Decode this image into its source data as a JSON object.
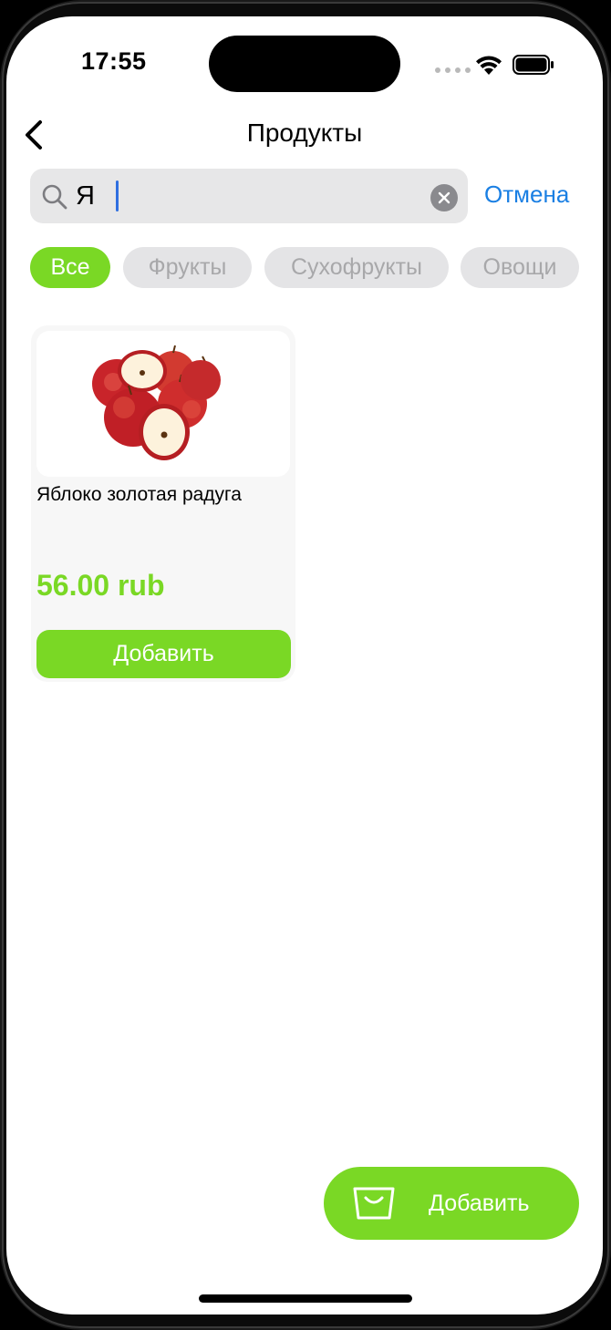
{
  "status_bar": {
    "time": "17:55"
  },
  "nav": {
    "title": "Продукты",
    "back_icon": "chevron-left-icon"
  },
  "search": {
    "value": "Я",
    "cancel_label": "Отмена"
  },
  "chips": [
    {
      "label": "Все",
      "active": true
    },
    {
      "label": "Фрукты",
      "active": false
    },
    {
      "label": "Сухофрукты",
      "active": false
    },
    {
      "label": "Овощи",
      "active": false
    }
  ],
  "products": [
    {
      "name": "Яблоко золотая радуга",
      "price": "56.00 rub",
      "add_label": "Добавить",
      "image": "red-apples"
    }
  ],
  "fab": {
    "label": "Добавить",
    "icon": "shopping-bag-icon"
  },
  "colors": {
    "accent": "#7ad825",
    "link": "#1a7fe3",
    "chip_inactive_bg": "#e4e4e6",
    "chip_inactive_text": "#a8a8aa"
  }
}
